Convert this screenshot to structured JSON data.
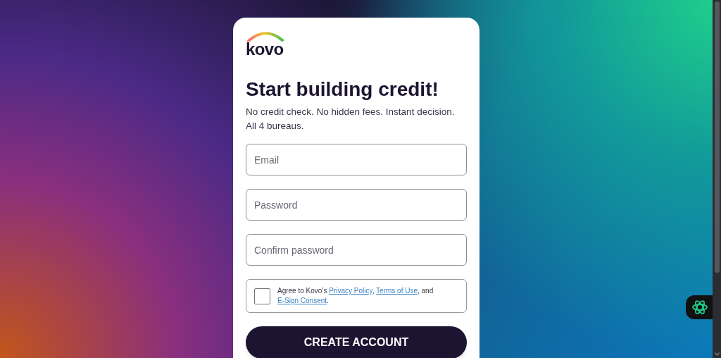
{
  "logo": {
    "text": "kovo"
  },
  "heading": "Start building credit!",
  "subtitle": "No credit check. No hidden fees. Instant decision. All 4 bureaus.",
  "fields": [
    {
      "placeholder": "Email"
    },
    {
      "placeholder": "Password"
    },
    {
      "placeholder": "Confirm password"
    }
  ],
  "consent": {
    "checked": false,
    "parts": [
      {
        "kind": "text",
        "text": "Agree to Kovo’s "
      },
      {
        "kind": "link",
        "text": "Privacy Policy"
      },
      {
        "kind": "text",
        "text": ", "
      },
      {
        "kind": "link",
        "text": "Terms of Use"
      },
      {
        "kind": "text",
        "text": ", and "
      },
      {
        "kind": "link",
        "text": "E-Sign Consent"
      },
      {
        "kind": "text",
        "text": "."
      }
    ]
  },
  "button": "CREATE ACCOUNT"
}
